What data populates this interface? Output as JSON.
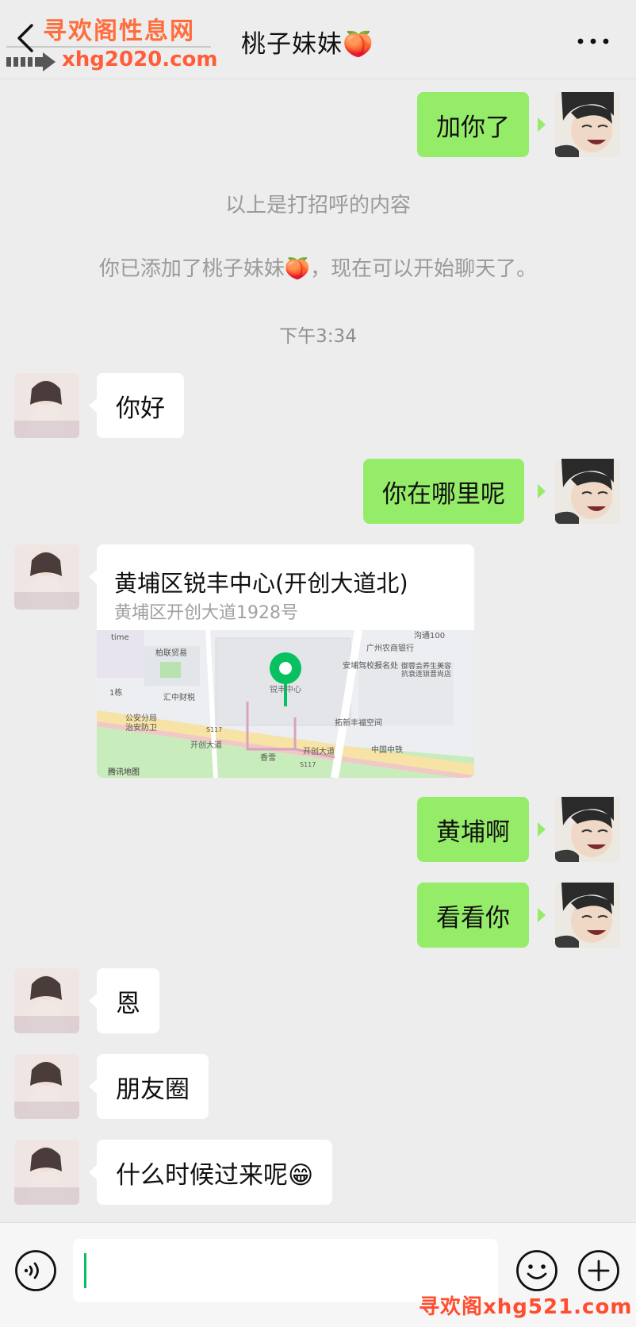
{
  "header": {
    "title": "桃子妹妹🍑",
    "watermark_name": "寻欢阁性息网",
    "watermark_url": "xhg2020.com"
  },
  "messages": {
    "m1": "加你了",
    "sys1": "以上是打招呼的内容",
    "sys2": "你已添加了桃子妹妹🍑，现在可以开始聊天了。",
    "time": "下午3:34",
    "m2": "你好",
    "m3": "你在哪里呢",
    "location": {
      "name": "黄埔区锐丰中心(开创大道北)",
      "address": "黄埔区开创大道1928号",
      "map_labels": {
        "time": "time",
        "bailian": "柏联贸易",
        "b1": "1栋",
        "huizhong": "汇中财税",
        "police1": "公安分局",
        "police2": "治安防卫",
        "ruifeng": "锐丰中心",
        "road1": "开创大道",
        "road2": "开创大道",
        "xiangxue": "香雪",
        "s117a": "S117",
        "s117b": "S117",
        "gougou": "沟通100",
        "bank": "广州农商银行",
        "anlu": "安埔驾校报名处",
        "yurong1": "御蓉会养生美容",
        "yurong2": "抗衰连锁晋尚店",
        "tuoxin": "拓新丰福空间",
        "zhongtie": "中国中铁",
        "credit": "腾讯地图"
      }
    },
    "m4": "黄埔啊",
    "m5": "看看你",
    "m6": "恩",
    "m7": "朋友圈",
    "m8": "什么时候过来呢😁"
  },
  "input": {
    "value": ""
  },
  "footer_watermark": "寻欢阁xhg521.com"
}
